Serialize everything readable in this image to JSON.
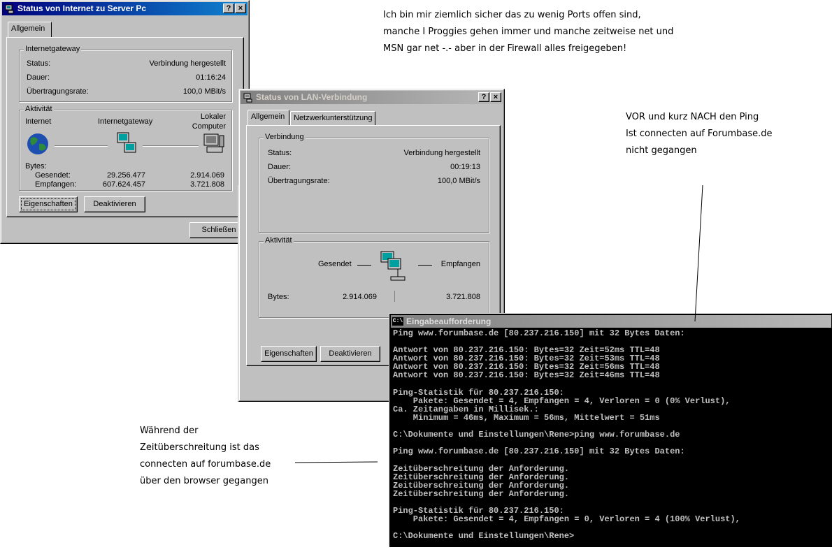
{
  "dialog_internet": {
    "title": "Status von Internet zu Server Pc",
    "help": "?",
    "close": "×",
    "tab_general": "Allgemein",
    "group_gateway": "Internetgateway",
    "status_label": "Status:",
    "status_value": "Verbindung hergestellt",
    "duration_label": "Dauer:",
    "duration_value": "01:16:24",
    "rate_label": "Übertragungsrate:",
    "rate_value": "100,0 MBit/s",
    "group_activity": "Aktivität",
    "col_internet": "Internet",
    "col_gateway": "Internetgateway",
    "col_local_1": "Lokaler",
    "col_local_2": "Computer",
    "bytes_label": "Bytes:",
    "sent_label": "Gesendet:",
    "sent_internet": "29.256.477",
    "sent_local": "2.914.069",
    "recv_label": "Empfangen:",
    "recv_internet": "607.624.457",
    "recv_local": "3.721.808",
    "properties_button": "Eigenschaften",
    "deactivate_button": "Deaktivieren",
    "close_button": "Schließen"
  },
  "dialog_lan": {
    "title": "Status von LAN-Verbindung",
    "help": "?",
    "close": "×",
    "tab_general": "Allgemein",
    "tab_support": "Netzwerkunterstützung",
    "group_connection": "Verbindung",
    "status_label": "Status:",
    "status_value": "Verbindung hergestellt",
    "duration_label": "Dauer:",
    "duration_value": "00:19:13",
    "rate_label": "Übertragungsrate:",
    "rate_value": "100,0 MBit/s",
    "group_activity": "Aktivität",
    "sent_label": "Gesendet",
    "received_label": "Empfangen",
    "bytes_label": "Bytes:",
    "bytes_sent": "2.914.069",
    "bytes_received": "3.721.808",
    "properties_button": "Eigenschaften",
    "deactivate_button": "Deaktivieren"
  },
  "console": {
    "title": "Eingabeaufforderung",
    "icon_text": "C:\\",
    "lines": [
      "Ping www.forumbase.de [80.237.216.150] mit 32 Bytes Daten:",
      "",
      "Antwort von 80.237.216.150: Bytes=32 Zeit=52ms TTL=48",
      "Antwort von 80.237.216.150: Bytes=32 Zeit=53ms TTL=48",
      "Antwort von 80.237.216.150: Bytes=32 Zeit=56ms TTL=48",
      "Antwort von 80.237.216.150: Bytes=32 Zeit=46ms TTL=48",
      "",
      "Ping-Statistik für 80.237.216.150:",
      "    Pakete: Gesendet = 4, Empfangen = 4, Verloren = 0 (0% Verlust),",
      "Ca. Zeitangaben in Millisek.:",
      "    Minimum = 46ms, Maximum = 56ms, Mittelwert = 51ms",
      "",
      "C:\\Dokumente und Einstellungen\\Rene>ping www.forumbase.de",
      "",
      "Ping www.forumbase.de [80.237.216.150] mit 32 Bytes Daten:",
      "",
      "Zeitüberschreitung der Anforderung.",
      "Zeitüberschreitung der Anforderung.",
      "Zeitüberschreitung der Anforderung.",
      "Zeitüberschreitung der Anforderung.",
      "",
      "Ping-Statistik für 80.237.216.150:",
      "    Pakete: Gesendet = 4, Empfangen = 0, Verloren = 4 (100% Verlust),",
      "",
      "C:\\Dokumente und Einstellungen\\Rene>"
    ]
  },
  "annotations": {
    "top_note": [
      "Ich bin mir ziemlich sicher das zu wenig Ports offen sind,",
      "manche I Proggies gehen immer und manche zeitweise net und",
      "MSN gar net -.- aber in der Firewall alles freigegeben!"
    ],
    "ping_note": [
      "VOR und kurz NACH den Ping",
      "Ist connecten auf Forumbase.de",
      "nicht gegangen"
    ],
    "timeout_note": [
      "Während der",
      "Zeitüberschreitung ist das",
      "connecten auf forumbase.de",
      "über den browser gegangen"
    ]
  }
}
